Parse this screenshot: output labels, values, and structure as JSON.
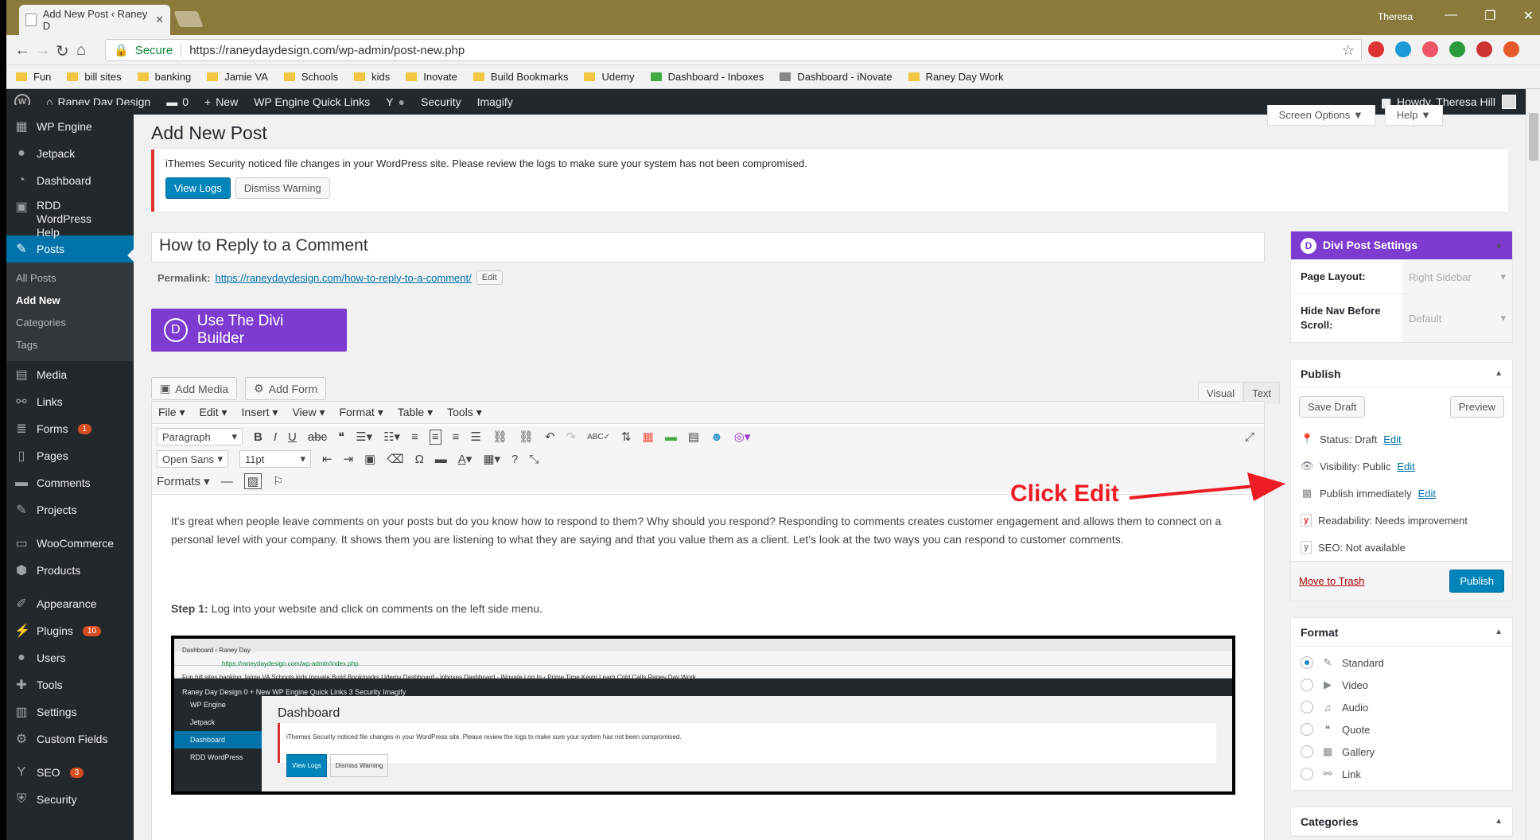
{
  "browser": {
    "tab_title": "Add New Post ‹ Raney D",
    "profile": "Theresa",
    "secure_label": "Secure",
    "url": "https://raneydaydesign.com/wp-admin/post-new.php",
    "bookmarks": [
      "Fun",
      "bill sites",
      "banking",
      "Jamie VA",
      "Schools",
      "kids",
      "Inovate",
      "Build Bookmarks",
      "Udemy",
      "Dashboard - Inboxes",
      "Dashboard - iNovate",
      "Raney Day Work"
    ]
  },
  "adminbar": {
    "site_name": "Raney Day Design",
    "comments_count": "0",
    "new_label": "New",
    "quick_links": "WP Engine Quick Links",
    "security": "Security",
    "imagify": "Imagify",
    "howdy": "Howdy, Theresa Hill"
  },
  "sidebar": {
    "items": [
      {
        "label": "WP Engine",
        "icon": "grid-icon"
      },
      {
        "label": "Jetpack",
        "icon": "jetpack-icon"
      },
      {
        "label": "Dashboard",
        "icon": "dashboard-icon"
      },
      {
        "label": "RDD WordPress Help",
        "icon": "help-icon"
      },
      {
        "label": "Posts",
        "icon": "pin-icon"
      },
      {
        "label": "Media",
        "icon": "media-icon"
      },
      {
        "label": "Links",
        "icon": "link-icon"
      },
      {
        "label": "Forms",
        "icon": "forms-icon",
        "badge": "1"
      },
      {
        "label": "Pages",
        "icon": "pages-icon"
      },
      {
        "label": "Comments",
        "icon": "comments-icon"
      },
      {
        "label": "Projects",
        "icon": "projects-icon"
      },
      {
        "label": "WooCommerce",
        "icon": "woo-icon"
      },
      {
        "label": "Products",
        "icon": "products-icon"
      },
      {
        "label": "Appearance",
        "icon": "brush-icon"
      },
      {
        "label": "Plugins",
        "icon": "plugin-icon",
        "badge": "10"
      },
      {
        "label": "Users",
        "icon": "users-icon"
      },
      {
        "label": "Tools",
        "icon": "tools-icon"
      },
      {
        "label": "Settings",
        "icon": "settings-icon"
      },
      {
        "label": "Custom Fields",
        "icon": "gear-icon"
      },
      {
        "label": "SEO",
        "icon": "yoast-icon",
        "badge": "3"
      },
      {
        "label": "Security",
        "icon": "shield-icon"
      }
    ],
    "posts_sub": [
      "All Posts",
      "Add New",
      "Categories",
      "Tags"
    ]
  },
  "screen_options": "Screen Options",
  "help": "Help",
  "page_title": "Add New Post",
  "notice": {
    "text": "iThemes Security noticed file changes in your WordPress site. Please review the logs to make sure your system has not been compromised.",
    "view_logs": "View Logs",
    "dismiss": "Dismiss Warning"
  },
  "post": {
    "title": "How to Reply to a Comment",
    "permalink_label": "Permalink:",
    "permalink_url": "https://raneydaydesign.com/how-to-reply-to-a-comment/",
    "edit": "Edit",
    "divi_builder": "Use The Divi Builder",
    "add_media": "Add Media",
    "add_form": "Add Form",
    "tab_visual": "Visual",
    "tab_text": "Text"
  },
  "editor": {
    "menus": [
      "File",
      "Edit",
      "Insert",
      "View",
      "Format",
      "Table",
      "Tools"
    ],
    "block_format": "Paragraph",
    "font_family": "Open Sans",
    "font_size": "11pt",
    "formats": "Formats",
    "paragraph": "It's great when people leave comments on your posts but do you know how to respond to them?  Why should you respond? Responding to comments creates customer engagement and allows them to connect on a personal level with your company.  It shows them you are listening to what they are saying and that you value them as a client. Let's look at the two ways you can respond to customer comments.",
    "step1_label": "Step 1:",
    "step1_text": " Log into your website and click on comments on the left side menu."
  },
  "embedded": {
    "tab": "Dashboard ‹ Raney Day",
    "url": "https://raneydaydesign.com/wp-admin/index.php",
    "bookmarks": "Fun  bill sites  banking  Jamie VA  Schools  kids  Inovate  Build Bookmarks  Udemy  Dashboard - Inboxes  Dashboard - iNovate  Log In ‹ Prime Time  Kevin  Learn Cold Calls  Raney Day Work",
    "admin": "Raney Day Design   0   + New   WP Engine Quick Links   3   Security   Imagify",
    "side": [
      "WP Engine",
      "Jetpack",
      "Dashboard",
      "RDD WordPress"
    ],
    "title": "Dashboard",
    "notice": "iThemes Security noticed file changes in your WordPress site. Please review the logs to make sure your system has not been compromised.",
    "view_logs": "View Logs",
    "dismiss": "Dismiss Warning"
  },
  "divi_settings": {
    "title": "Divi Post Settings",
    "page_layout_label": "Page Layout:",
    "page_layout_value": "Right Sidebar",
    "hide_nav_label": "Hide Nav Before Scroll:",
    "hide_nav_value": "Default"
  },
  "publish": {
    "title": "Publish",
    "save_draft": "Save Draft",
    "preview": "Preview",
    "status": "Status: Draft",
    "visibility": "Visibility: Public",
    "publish_when": "Publish immediately",
    "edit": "Edit",
    "readability": "Readability: Needs improvement",
    "seo": "SEO: Not available",
    "trash": "Move to Trash",
    "publish_btn": "Publish"
  },
  "format": {
    "title": "Format",
    "options": [
      "Standard",
      "Video",
      "Audio",
      "Quote",
      "Gallery",
      "Link"
    ],
    "selected": "Standard"
  },
  "categories": {
    "title": "Categories"
  },
  "annotation": {
    "text": "Click Edit",
    "color": "#ee1c25"
  }
}
